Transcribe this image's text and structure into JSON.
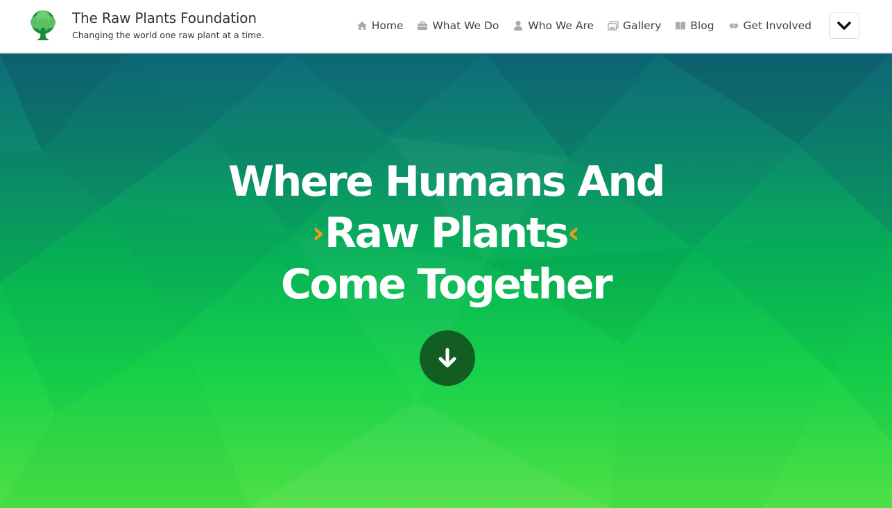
{
  "brand": {
    "title": "The Raw Plants Foundation",
    "tagline": "Changing the world one raw plant at a time.",
    "logo_icon": "tree-icon"
  },
  "nav": {
    "items": [
      {
        "label": "Home",
        "icon": "home-icon"
      },
      {
        "label": "What We Do",
        "icon": "briefcase-icon"
      },
      {
        "label": "Who We Are",
        "icon": "user-icon"
      },
      {
        "label": "Gallery",
        "icon": "pictures-icon"
      },
      {
        "label": "Blog",
        "icon": "book-icon"
      },
      {
        "label": "Get Involved",
        "icon": "handshake-icon"
      }
    ],
    "toggle_icon": "chevron-down-icon"
  },
  "hero": {
    "line1": "Where Humans And",
    "line2_open": "›",
    "line2": "Raw Plants",
    "line2_close": "‹",
    "line3": "Come Together",
    "scroll_icon": "arrow-down-icon"
  },
  "colors": {
    "accent_orange": "#f29a1b",
    "hero_green": "#16d24a",
    "hero_teal": "#0f6b7a",
    "button_dark_green": "#125e22"
  }
}
